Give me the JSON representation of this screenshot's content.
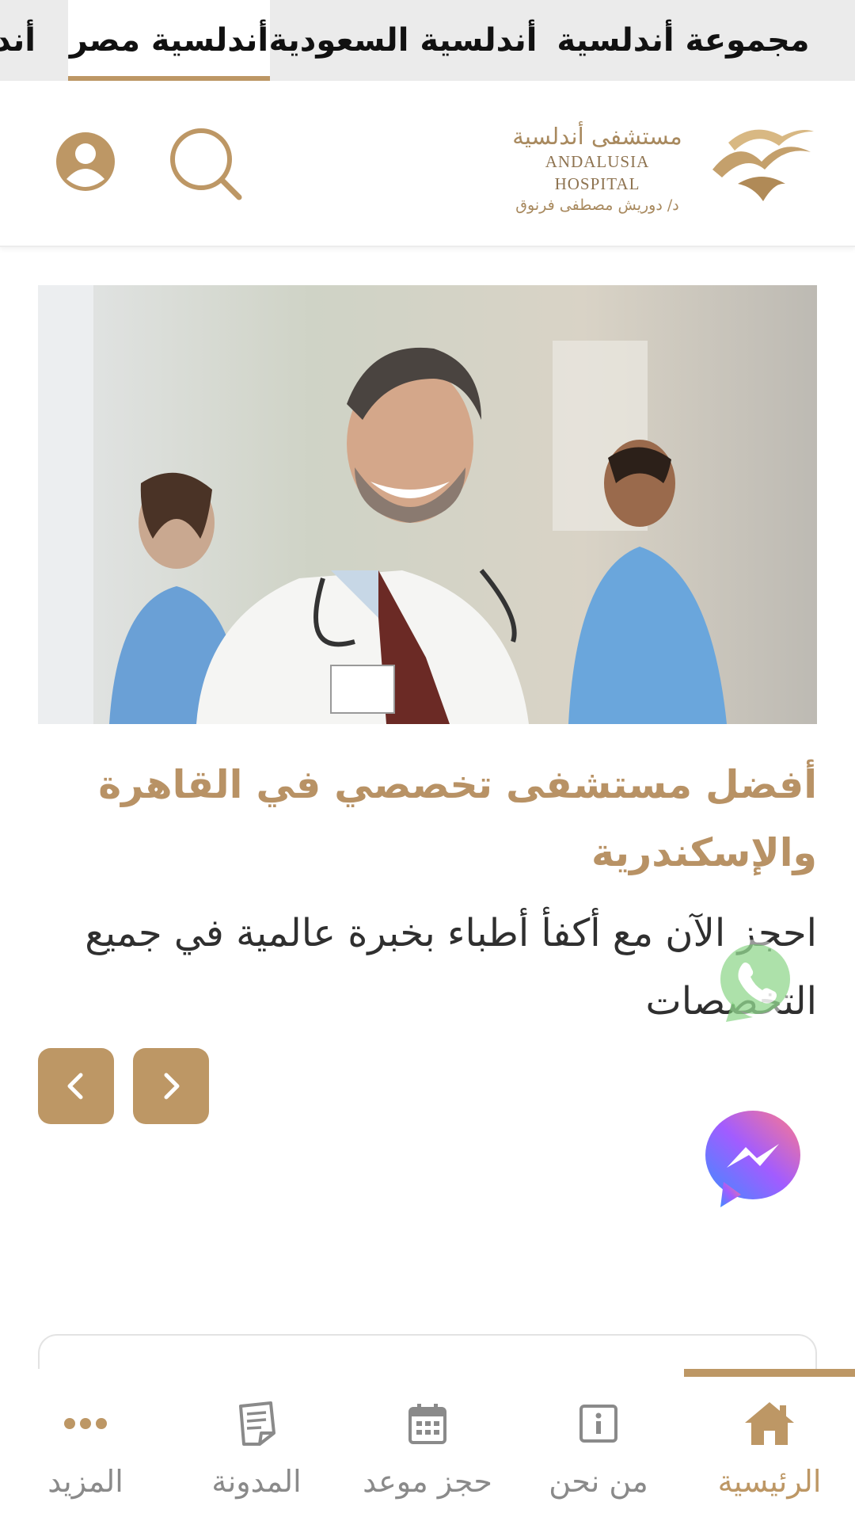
{
  "group_tabs": [
    {
      "label": "مجموعة أندلسية",
      "active": false
    },
    {
      "label": "أندلسية السعودية",
      "active": false
    },
    {
      "label": "أندلسية مصر",
      "active": true
    },
    {
      "label": "أندلسية",
      "active": false
    }
  ],
  "logo": {
    "name_ar": "مستشفى أندلسية",
    "name_en": "ANDALUSIA HOSPITAL",
    "tagline_ar": "د/ دوريش مصطفى فرنوق"
  },
  "header": {
    "search_icon": "search-icon",
    "account_icon": "user-icon"
  },
  "hero": {
    "image": "doctor-team-photo",
    "title": "أفضل مستشفى تخصصي في القاهرة والإسكندرية",
    "subtitle": "احجز الآن مع أكفأ أطباء بخبرة عالمية في جميع التخصصات"
  },
  "floating": {
    "whatsapp_icon": "whatsapp-icon",
    "messenger_icon": "messenger-icon"
  },
  "bottom_nav": [
    {
      "label": "الرئيسية",
      "icon": "home-icon",
      "active": true
    },
    {
      "label": "من نحن",
      "icon": "info-icon",
      "active": false
    },
    {
      "label": "حجز موعد",
      "icon": "calendar-icon",
      "active": false
    },
    {
      "label": "المدونة",
      "icon": "blog-icon",
      "active": false
    },
    {
      "label": "المزيد",
      "icon": "more-icon",
      "active": false
    }
  ],
  "colors": {
    "accent": "#bd9765",
    "tab_bar_bg": "#ebebeb",
    "nav_inactive": "#8a8a8a"
  }
}
